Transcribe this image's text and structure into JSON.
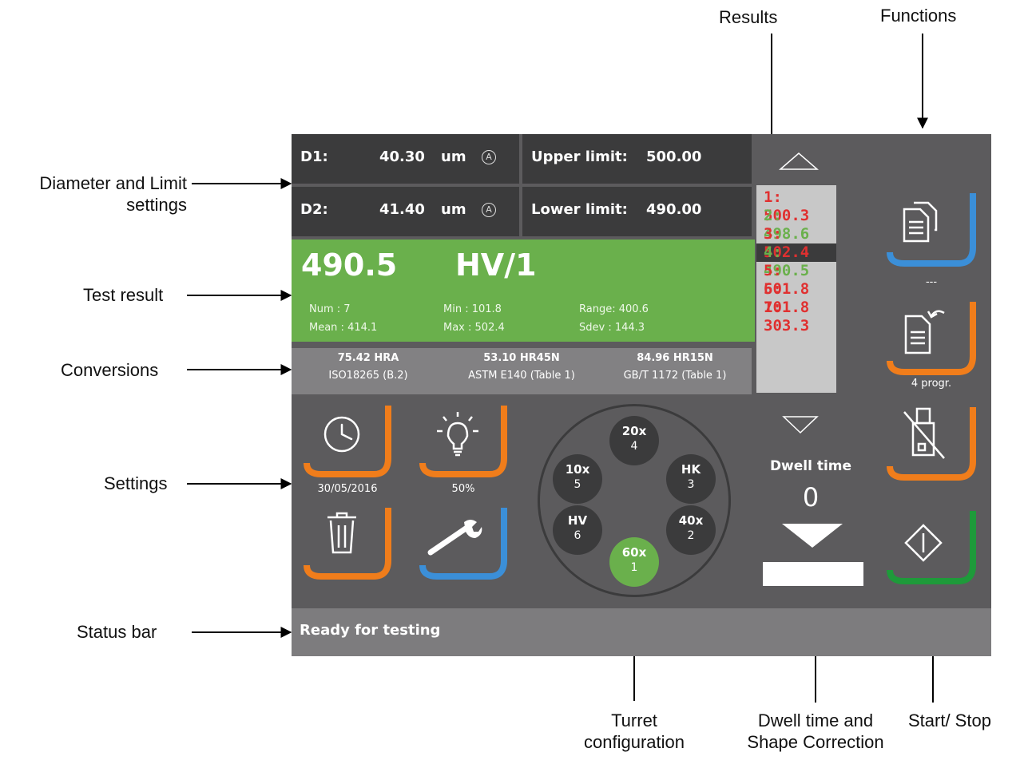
{
  "annotations": {
    "results": "Results",
    "functions": "Functions",
    "diameter_line1": "Diameter and Limit",
    "diameter_line2": "settings",
    "test_result": "Test result",
    "conversions": "Conversions",
    "settings": "Settings",
    "status_bar": "Status bar",
    "turret_line1": "Turret",
    "turret_line2": "configuration",
    "dwell_line1": "Dwell time and",
    "dwell_line2": "Shape Correction",
    "start_stop": "Start/ Stop"
  },
  "measurements": {
    "d1": {
      "label": "D1:",
      "value": "40.30",
      "unit": "um",
      "mode": "A"
    },
    "d2": {
      "label": "D2:",
      "value": "41.40",
      "unit": "um",
      "mode": "A"
    },
    "upper_limit": {
      "label": "Upper limit:",
      "value": "500.00"
    },
    "lower_limit": {
      "label": "Lower limit:",
      "value": "490.00"
    }
  },
  "test_result": {
    "value": "490.5",
    "unit": "HV/1",
    "num": "Num : 7",
    "mean": "Mean : 414.1",
    "min": "Min : 101.8",
    "max": "Max : 502.4",
    "range": "Range: 400.6",
    "sdev": "Sdev : 144.3",
    "color": "#6ab04c"
  },
  "conversions": [
    {
      "value": "75.42 HRA",
      "standard": "ISO18265 (B.2)"
    },
    {
      "value": "53.10 HR45N",
      "standard": "ASTM E140 (Table 1)"
    },
    {
      "value": "84.96 HR15N",
      "standard": "GB/T 1172 (Table 1)"
    }
  ],
  "results": [
    {
      "text": "1: 500.3",
      "status": "out",
      "selected": false
    },
    {
      "text": "2: 498.6",
      "status": "in",
      "selected": false
    },
    {
      "text": "3: 502.4",
      "status": "out",
      "selected": false
    },
    {
      "text": "4: 490.5",
      "status": "in",
      "selected": true
    },
    {
      "text": "5: 501.8",
      "status": "out",
      "selected": false
    },
    {
      "text": "6: 101.8",
      "status": "out",
      "selected": false
    },
    {
      "text": "7: 303.3",
      "status": "out",
      "selected": false
    }
  ],
  "settings": {
    "clock": {
      "icon": "clock-icon",
      "caption": "30/05/2016"
    },
    "light": {
      "icon": "light-bulb-icon",
      "caption": "50%"
    },
    "delete": {
      "icon": "trash-icon"
    },
    "service": {
      "icon": "wrench-icon"
    }
  },
  "functions": {
    "copy": {
      "icon": "copy-documents-icon",
      "caption": "---"
    },
    "program": {
      "icon": "document-reload-icon",
      "caption": "4 progr."
    },
    "usb": {
      "icon": "usb-disabled-icon"
    },
    "start": {
      "icon": "start-stop-icon"
    }
  },
  "turret": [
    {
      "magnification": "20x",
      "position": "4",
      "active": false
    },
    {
      "magnification": "HK",
      "position": "3",
      "active": false
    },
    {
      "magnification": "40x",
      "position": "2",
      "active": false
    },
    {
      "magnification": "60x",
      "position": "1",
      "active": true
    },
    {
      "magnification": "HV",
      "position": "6",
      "active": false
    },
    {
      "magnification": "10x",
      "position": "5",
      "active": false
    }
  ],
  "dwell": {
    "label": "Dwell time",
    "value": "0"
  },
  "status": {
    "text": "Ready for testing"
  },
  "colors": {
    "panel": "#5c5b5d",
    "dark": "#3b3b3c",
    "green": "#6ab04c",
    "red": "#e03030",
    "orange": "#f07d1b",
    "blue": "#3b8fd8",
    "dark_green": "#1e9a3a"
  }
}
